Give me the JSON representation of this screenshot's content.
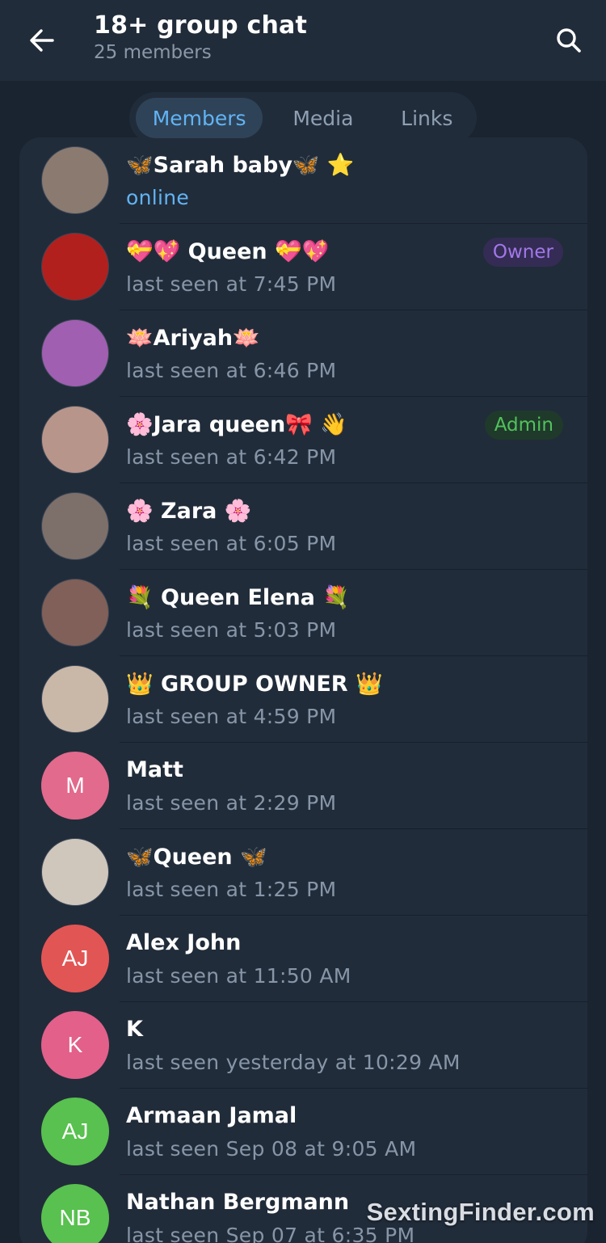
{
  "header": {
    "title": "18+ group chat",
    "subtitle": "25 members"
  },
  "tabs": [
    {
      "label": "Members",
      "active": true
    },
    {
      "label": "Media",
      "active": false
    },
    {
      "label": "Links",
      "active": false
    }
  ],
  "members": [
    {
      "name": "🦋Sarah baby🦋 ⭐",
      "status": "online",
      "badge": "",
      "initials": "",
      "avatar_color": "#8a7a70",
      "online": true
    },
    {
      "name": "💝💖 Queen 💝💖",
      "status": "last seen at 7:45 PM",
      "badge": "Owner",
      "initials": "",
      "avatar_color": "#b2201e"
    },
    {
      "name": "🪷Ariyah🪷",
      "status": "last seen at 6:46 PM",
      "badge": "",
      "initials": "",
      "avatar_color": "#a05fb0"
    },
    {
      "name": "🌸Jara queen🎀 👋",
      "status": "last seen at 6:42 PM",
      "badge": "Admin",
      "initials": "",
      "avatar_color": "#b8958a"
    },
    {
      "name": "🌸 Zara 🌸",
      "status": "last seen at 6:05 PM",
      "badge": "",
      "initials": "",
      "avatar_color": "#7d6f6a"
    },
    {
      "name": "💐 Queen Elena 💐",
      "status": "last seen at 5:03 PM",
      "badge": "",
      "initials": "",
      "avatar_color": "#806058"
    },
    {
      "name": "👑 GROUP OWNER 👑",
      "status": "last seen at 4:59 PM",
      "badge": "",
      "initials": "",
      "avatar_color": "#c9b7a8"
    },
    {
      "name": "Matt",
      "status": "last seen at 2:29 PM",
      "badge": "",
      "initials": "M",
      "avatar_color": "#e26a8d"
    },
    {
      "name": "🦋Queen 🦋",
      "status": "last seen at 1:25 PM",
      "badge": "",
      "initials": "",
      "avatar_color": "#cfc6bc"
    },
    {
      "name": "Alex John",
      "status": "last seen at 11:50 AM",
      "badge": "",
      "initials": "AJ",
      "avatar_color": "#e25555"
    },
    {
      "name": "K",
      "status": "last seen yesterday at 10:29 AM",
      "badge": "",
      "initials": "K",
      "avatar_color": "#e2608a"
    },
    {
      "name": "Armaan Jamal",
      "status": "last seen Sep 08 at 9:05 AM",
      "badge": "",
      "initials": "AJ",
      "avatar_color": "#58c14f"
    },
    {
      "name": "Nathan Bergmann",
      "status": "last seen Sep 07 at 6:35 PM",
      "badge": "",
      "initials": "NB",
      "avatar_color": "#58c14f"
    }
  ],
  "watermark": "SextingFinder.com",
  "colors": {
    "header_bg": "#212c3a",
    "page_bg": "#1a2330",
    "accent": "#61b4f5",
    "owner_badge": "#a277e8",
    "admin_badge": "#52c25c"
  },
  "icons": {
    "back": "arrow-left-icon",
    "search": "search-icon"
  }
}
